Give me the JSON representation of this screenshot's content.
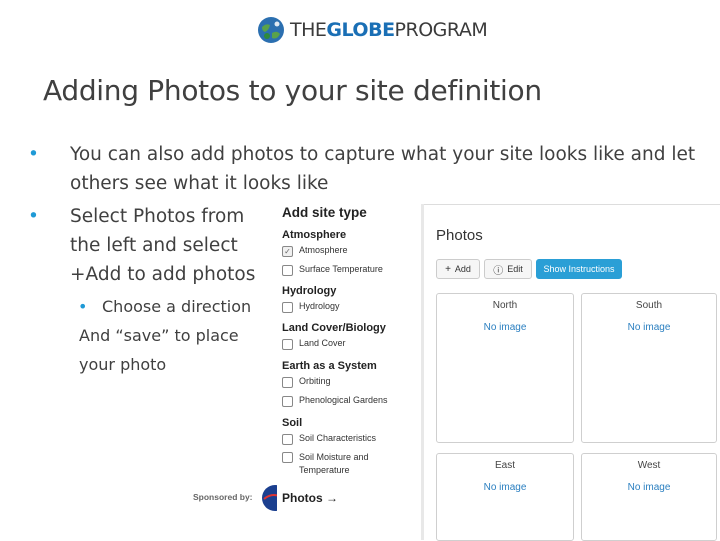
{
  "header": {
    "logo_prefix": "THE",
    "logo_bold": "GLOBE",
    "logo_suffix": "PROGRAM"
  },
  "slide": {
    "title": "Adding Photos to your site definition",
    "bullets": [
      "You can also add photos to capture what your site looks like and let others see what it looks like",
      "Select Photos from the left and select +Add to add photos"
    ],
    "sub_bullet_line1": "Choose a direction",
    "sub_bullet_rest": "And “save” to place your photo"
  },
  "site_panel": {
    "title": "Add site type",
    "categories": [
      {
        "name": "Atmosphere",
        "options": [
          {
            "label": "Atmosphere",
            "checked": true
          },
          {
            "label": "Surface Temperature",
            "checked": false
          }
        ]
      },
      {
        "name": "Hydrology",
        "options": [
          {
            "label": "Hydrology",
            "checked": false
          }
        ]
      },
      {
        "name": "Land Cover/Biology",
        "options": [
          {
            "label": "Land Cover",
            "checked": false
          }
        ]
      },
      {
        "name": "Earth as a System",
        "options": [
          {
            "label": "Orbiting",
            "checked": false
          },
          {
            "label": "Phenological Gardens",
            "checked": false
          }
        ]
      },
      {
        "name": "Soil",
        "options": [
          {
            "label": "Soil Characteristics",
            "checked": false
          },
          {
            "label": "Soil Moisture and Temperature",
            "checked": false
          }
        ]
      }
    ],
    "photos_link": "Photos →"
  },
  "photos_panel": {
    "heading": "Photos",
    "add_label": "Add",
    "edit_label": "Edit",
    "instructions_label": "Show Instructions",
    "cards": [
      {
        "direction": "North",
        "image_text": "No image"
      },
      {
        "direction": "South",
        "image_text": "No image"
      },
      {
        "direction": "East",
        "image_text": "No image"
      },
      {
        "direction": "West",
        "image_text": "No image"
      }
    ]
  },
  "sponsor": {
    "label": "Sponsored by:"
  },
  "colors": {
    "accent": "#1f9ad6",
    "button_primary": "#2a9fd6",
    "link": "#2a7fc0"
  }
}
